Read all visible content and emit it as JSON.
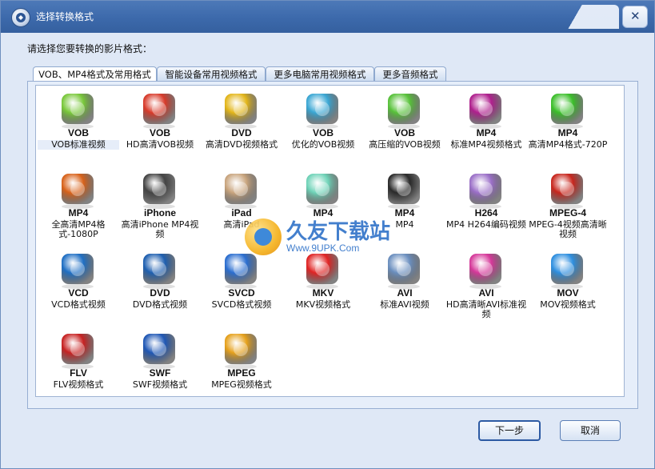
{
  "window": {
    "title": "选择转换格式"
  },
  "prompt": "请选择您要转换的影片格式：",
  "tabs": [
    {
      "label": "VOB、MP4格式及常用格式",
      "active": true
    },
    {
      "label": "智能设备常用视频格式",
      "active": false
    },
    {
      "label": "更多电脑常用视频格式",
      "active": false
    },
    {
      "label": "更多音频格式",
      "active": false
    }
  ],
  "formats": [
    {
      "code": "VOB",
      "label": "VOB标准视频",
      "icon": "green-drive-icon",
      "color": "#79c83a"
    },
    {
      "code": "VOB",
      "label": "HD高清VOB视频",
      "icon": "popcorn-film-icon",
      "color": "#d83a2a"
    },
    {
      "code": "DVD",
      "label": "高清DVD视频格式",
      "icon": "gold-disc-icon",
      "color": "#e3b61a"
    },
    {
      "code": "VOB",
      "label": "优化的VOB视频",
      "icon": "gift-box-icon",
      "color": "#3aa7d4"
    },
    {
      "code": "VOB",
      "label": "高压缩的VOB视频",
      "icon": "green-disc-box-icon",
      "color": "#58c23a"
    },
    {
      "code": "MP4",
      "label": "标准MP4视频格式",
      "icon": "video-player-icon",
      "color": "#b01f8e"
    },
    {
      "code": "MP4",
      "label": "高清MP4格式-720P",
      "icon": "green-globe-icon",
      "color": "#3bbf2a"
    },
    {
      "code": "MP4",
      "label": "全高清MP4格式-1080P",
      "icon": "monitor-icon",
      "color": "#d8621a"
    },
    {
      "code": "iPhone",
      "label": "高清iPhone MP4视频",
      "icon": "iphone-icon",
      "color": "#444444"
    },
    {
      "code": "iPad",
      "label": "高清iPad",
      "icon": "ipad-icon",
      "color": "#c9a57e"
    },
    {
      "code": "MP4",
      "label": "",
      "icon": "phones-icon",
      "color": "#6fd3b8"
    },
    {
      "code": "MP4",
      "label": "MP4",
      "icon": "wide-screen-icon",
      "color": "#2a2a2a"
    },
    {
      "code": "H264",
      "label": "MP4 H264编码视频",
      "icon": "camera-lens-icon",
      "color": "#9b6fc8"
    },
    {
      "code": "MPEG-4",
      "label": "MPEG-4视频高清晰视频",
      "icon": "film-reel-icon",
      "color": "#c8261d"
    },
    {
      "code": "VCD",
      "label": "VCD格式视频",
      "icon": "blue-disc-icon",
      "color": "#1f6fc4"
    },
    {
      "code": "DVD",
      "label": "DVD格式视频",
      "icon": "dvd-case-icon",
      "color": "#1e5fb0"
    },
    {
      "code": "SVCD",
      "label": "SVCD格式视频",
      "icon": "svcd-disc-icon",
      "color": "#2b6ed0"
    },
    {
      "code": "MKV",
      "label": "MKV视频格式",
      "icon": "red-box-icon",
      "color": "#e02424"
    },
    {
      "code": "AVI",
      "label": "标准AVI视频",
      "icon": "avi-disc-icon",
      "color": "#6b8fbf"
    },
    {
      "code": "AVI",
      "label": "HD高清晰AVI标准视频",
      "icon": "display-icon",
      "color": "#d6389a"
    },
    {
      "code": "MOV",
      "label": "MOV视频格式",
      "icon": "quicktime-icon",
      "color": "#2e8fe0"
    },
    {
      "code": "FLV",
      "label": "FLV视频格式",
      "icon": "flv-ring-icon",
      "color": "#c72222"
    },
    {
      "code": "SWF",
      "label": "SWF视频格式",
      "icon": "facebook-ball-icon",
      "color": "#1f57b5"
    },
    {
      "code": "MPEG",
      "label": "MPEG视频格式",
      "icon": "chrome-ball-icon",
      "color": "#e6a11c"
    }
  ],
  "watermark": {
    "brand": "久友下载站",
    "url": "Www.9UPK.Com"
  },
  "buttons": {
    "next": "下一步",
    "cancel": "取消"
  }
}
